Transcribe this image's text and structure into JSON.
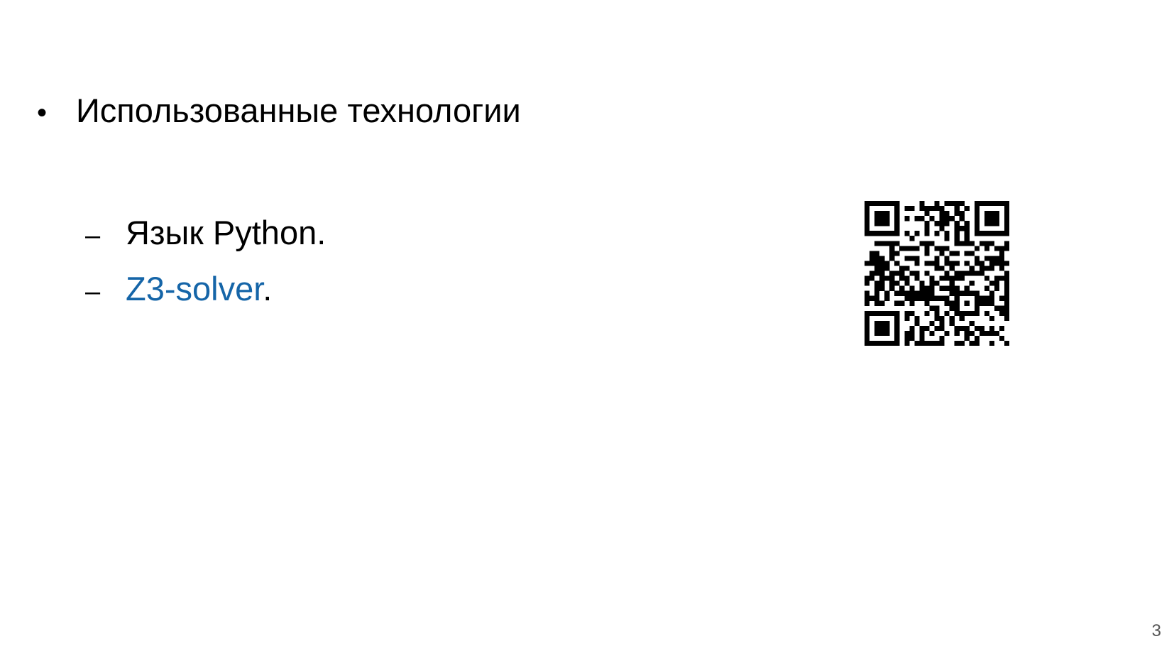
{
  "slide": {
    "main_bullet": {
      "marker": "•",
      "text": "Использованные технологии"
    },
    "sub_items": [
      {
        "marker": "–",
        "text": "Язык Python."
      },
      {
        "marker": "–",
        "link_text": "Z3-solver",
        "suffix": "."
      }
    ],
    "qr_code": {
      "icon": "qr-code-icon",
      "color": "#000000"
    },
    "page_number": "3"
  },
  "colors": {
    "text": "#000000",
    "link": "#1565a8",
    "background": "#ffffff",
    "page_number": "#555555"
  }
}
